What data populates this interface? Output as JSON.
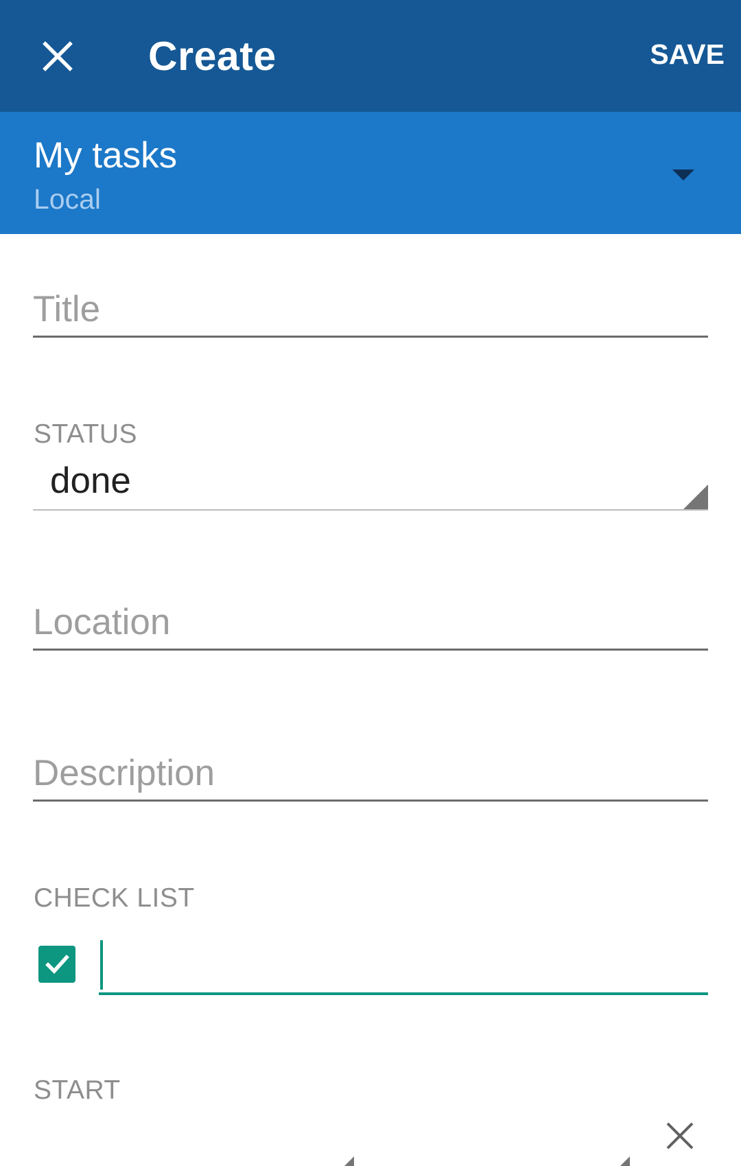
{
  "appbar": {
    "title": "Create",
    "save_label": "SAVE",
    "close_icon": "close-icon",
    "color": "#155895"
  },
  "list_picker": {
    "name": "My tasks",
    "account": "Local",
    "color": "#1c78c8",
    "arrow_icon": "dropdown-arrow-icon"
  },
  "fields": {
    "title_placeholder": "Title",
    "status_label": "STATUS",
    "status_value": "done",
    "location_placeholder": "Location",
    "description_placeholder": "Description",
    "checklist_label": "CHECK LIST",
    "checklist_item_value": "",
    "checklist_item_checked": true,
    "start_label": "START"
  },
  "colors": {
    "accent": "#0d9680"
  }
}
